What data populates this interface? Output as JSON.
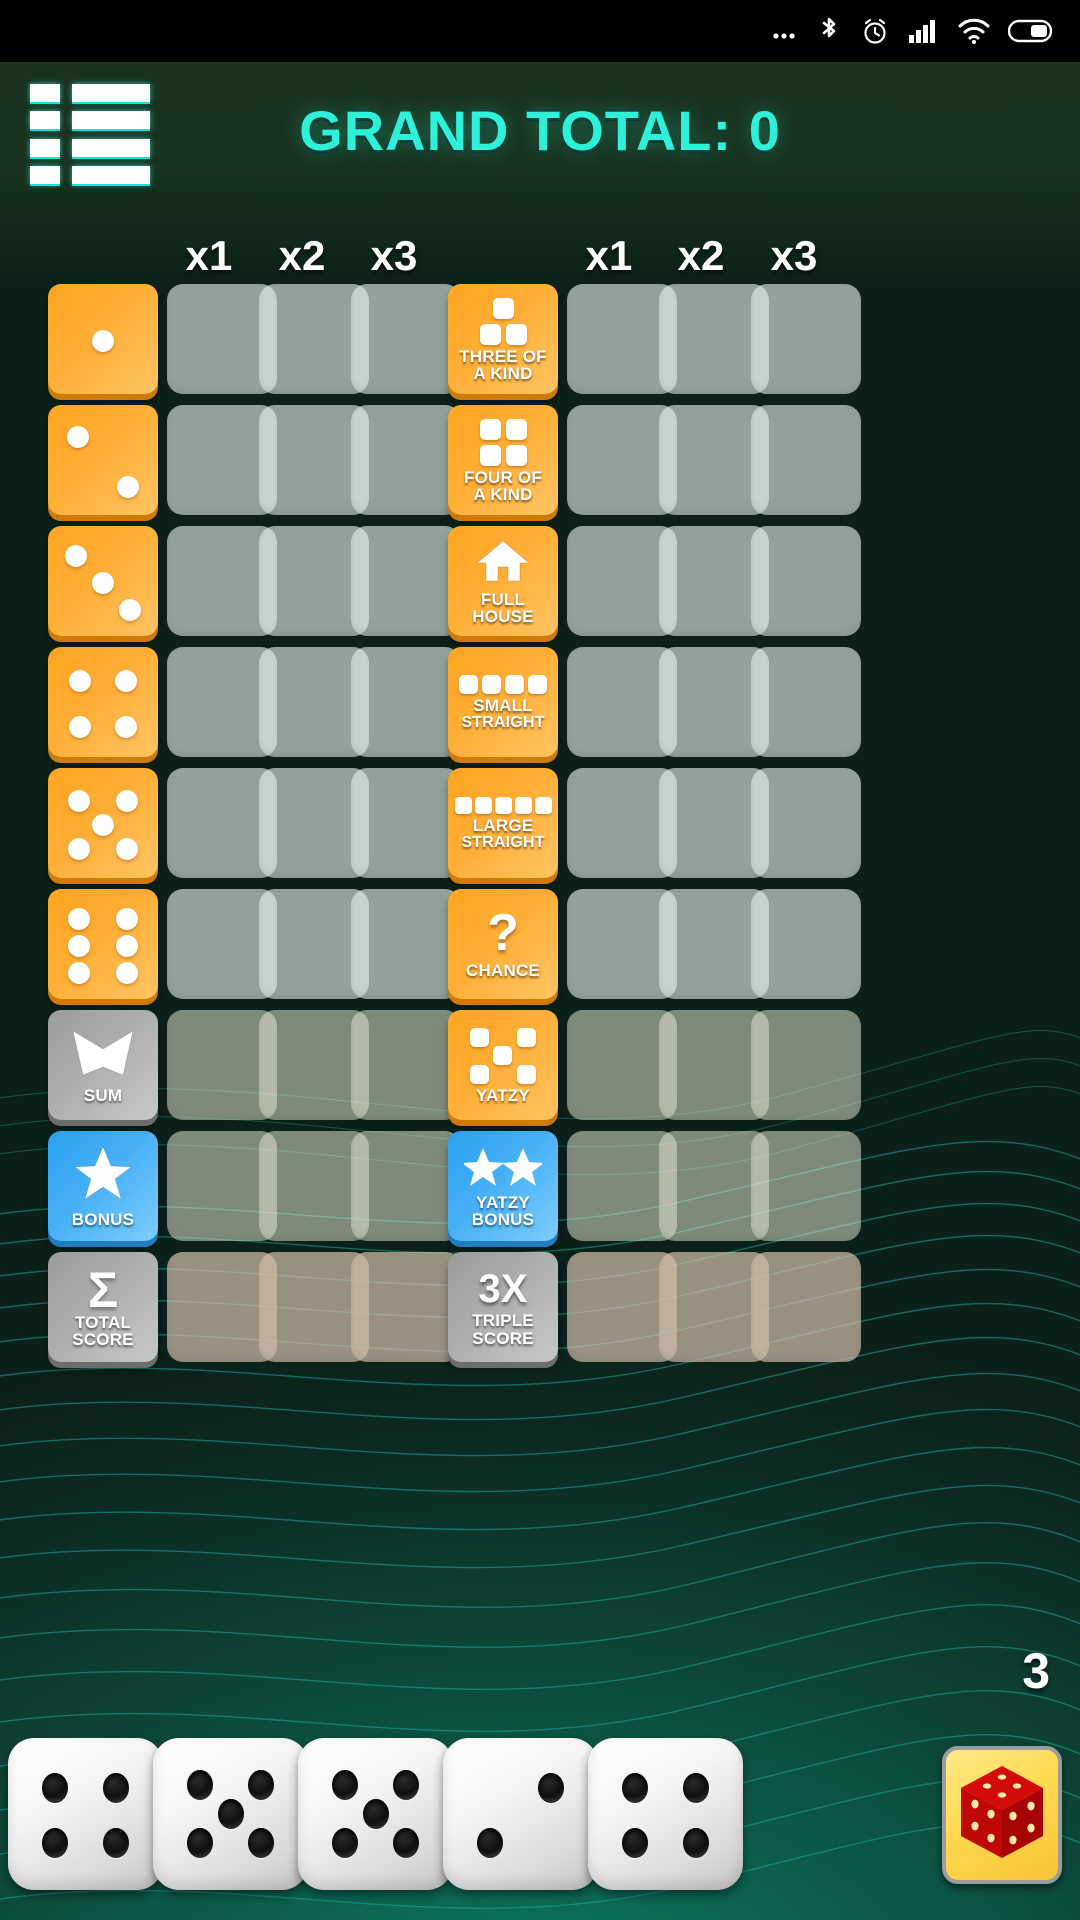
{
  "statusbar": {
    "icons": [
      "more-dots-icon",
      "bluetooth-icon",
      "alarm-clock-icon",
      "cellular-signal-icon",
      "wifi-icon",
      "battery-icon"
    ]
  },
  "header": {
    "menu_icon": "hamburger-list-icon",
    "grand_total_label": "GRAND TOTAL: 0"
  },
  "board": {
    "column_headers": [
      "x1",
      "x2",
      "x3",
      "x1",
      "x2",
      "x3"
    ],
    "left_categories": [
      {
        "name": "ones",
        "icon": "die-1-icon",
        "label": "",
        "style": "orange"
      },
      {
        "name": "twos",
        "icon": "die-2-icon",
        "label": "",
        "style": "orange"
      },
      {
        "name": "threes",
        "icon": "die-3-icon",
        "label": "",
        "style": "orange"
      },
      {
        "name": "fours",
        "icon": "die-4-icon",
        "label": "",
        "style": "orange"
      },
      {
        "name": "fives",
        "icon": "die-5-icon",
        "label": "",
        "style": "orange"
      },
      {
        "name": "sixes",
        "icon": "die-6-icon",
        "label": "",
        "style": "orange"
      },
      {
        "name": "sum",
        "icon": "chevron-down-icon",
        "label": "SUM",
        "style": "gray"
      },
      {
        "name": "bonus",
        "icon": "star-icon",
        "label": "BONUS",
        "style": "blue"
      },
      {
        "name": "total-score",
        "icon": "sigma-icon",
        "label": "TOTAL\nSCORE",
        "label1": "TOTAL",
        "label2": "SCORE",
        "style": "gray"
      }
    ],
    "right_categories": [
      {
        "name": "three-of-a-kind",
        "icon": "three-squares-icon",
        "label1": "THREE OF",
        "label2": "A KIND",
        "style": "orange"
      },
      {
        "name": "four-of-a-kind",
        "icon": "four-squares-icon",
        "label1": "FOUR OF",
        "label2": "A KIND",
        "style": "orange"
      },
      {
        "name": "full-house",
        "icon": "house-icon",
        "label1": "FULL",
        "label2": "HOUSE",
        "style": "orange"
      },
      {
        "name": "small-straight",
        "icon": "four-in-row-icon",
        "label1": "SMALL",
        "label2": "STRAIGHT",
        "style": "orange"
      },
      {
        "name": "large-straight",
        "icon": "five-in-row-icon",
        "label1": "LARGE",
        "label2": "STRAIGHT",
        "style": "orange"
      },
      {
        "name": "chance",
        "icon": "question-mark-icon",
        "label1": "CHANCE",
        "label2": "",
        "style": "orange"
      },
      {
        "name": "yatzy",
        "icon": "five-dice-pattern-icon",
        "label1": "YATZY",
        "label2": "",
        "style": "orange"
      },
      {
        "name": "yatzy-bonus",
        "icon": "double-star-icon",
        "label1": "YATZY",
        "label2": "BONUS",
        "style": "blue"
      },
      {
        "name": "triple-score",
        "icon": "3x-text-icon",
        "big": "3X",
        "label1": "TRIPLE",
        "label2": "SCORE",
        "style": "gray"
      }
    ],
    "score_cells": [
      [
        "",
        "",
        "",
        "",
        "",
        ""
      ],
      [
        "",
        "",
        "",
        "",
        "",
        ""
      ],
      [
        "",
        "",
        "",
        "",
        "",
        ""
      ],
      [
        "",
        "",
        "",
        "",
        "",
        ""
      ],
      [
        "",
        "",
        "",
        "",
        "",
        ""
      ],
      [
        "",
        "",
        "",
        "",
        "",
        ""
      ],
      [
        "",
        "",
        "",
        "",
        "",
        ""
      ],
      [
        "",
        "",
        "",
        "",
        "",
        ""
      ],
      [
        "",
        "",
        "",
        "",
        "",
        ""
      ]
    ]
  },
  "tray": {
    "rolls_remaining": "3",
    "dice": [
      4,
      5,
      5,
      2,
      4
    ],
    "roll_button_icon": "red-dice-icon"
  },
  "colors": {
    "accent_cyan": "#2ff0d8",
    "tile_orange": "#ffae35",
    "tile_blue": "#46b0f6",
    "tile_gray": "#adadad",
    "board_bg": "#0b5f4c",
    "empty_cell": "#e0f3ec"
  }
}
